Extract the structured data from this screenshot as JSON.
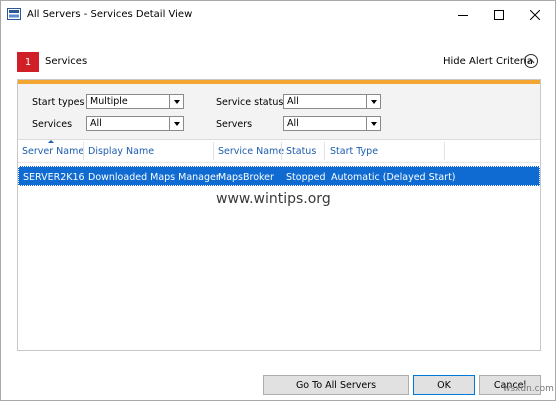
{
  "window": {
    "title": "All Servers - Services Detail View"
  },
  "alert": {
    "count": "1",
    "label": "Services",
    "hide_criteria": "Hide Alert Criteria"
  },
  "criteria": {
    "start_types_label": "Start types",
    "start_types_value": "Multiple",
    "service_status_label": "Service status",
    "service_status_value": "All",
    "services_label": "Services",
    "services_value": "All",
    "servers_label": "Servers",
    "servers_value": "All"
  },
  "grid": {
    "columns": [
      "Server Name",
      "Display Name",
      "Service Name",
      "Status",
      "Start Type"
    ],
    "rows": [
      [
        "SERVER2K16",
        "Downloaded Maps Manager",
        "MapsBroker",
        "Stopped",
        "Automatic (Delayed Start)"
      ]
    ]
  },
  "watermark": "www.wintips.org",
  "corner_mark": "wsxdn.com",
  "buttons": {
    "goto": "Go To All Servers",
    "ok": "OK",
    "cancel": "Cancel"
  },
  "colors": {
    "alert_red": "#d11f28",
    "accent_orange": "#f2a531",
    "selection_blue": "#0f6bd1",
    "header_text_blue": "#1c5cb0"
  },
  "icons": {
    "title": "server-manager-icon",
    "hide": "chevron-up-icon"
  }
}
